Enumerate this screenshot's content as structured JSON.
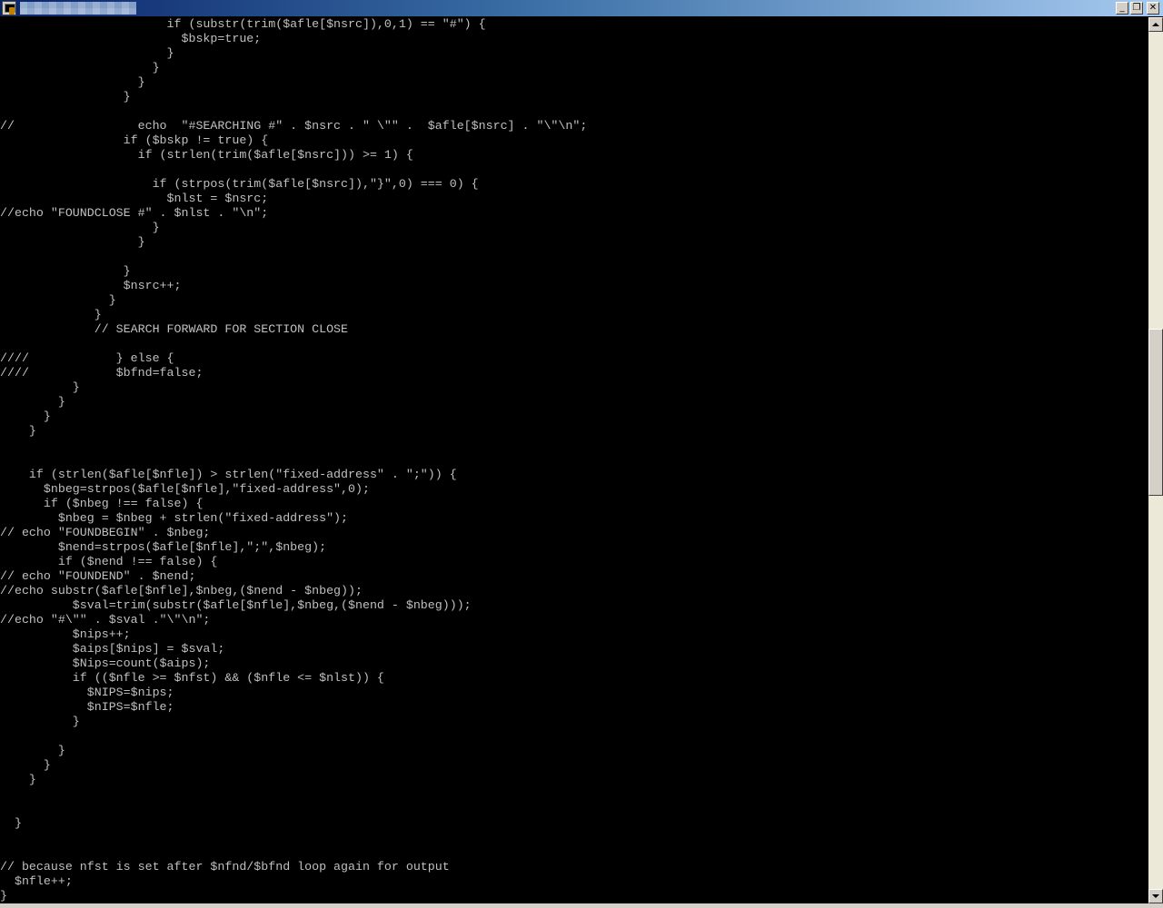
{
  "window": {
    "controls": {
      "minimize_glyph": "_",
      "maximize_glyph": "❐",
      "close_glyph": "✕"
    },
    "icon": "terminal-app-icon"
  },
  "terminal": {
    "text_color": "#c0c0c0",
    "background": "#000000",
    "lines": [
      "                       if (substr(trim($afle[$nsrc]),0,1) == \"#\") {",
      "                         $bskp=true;",
      "                       }",
      "                     }",
      "                   }",
      "                 }",
      "",
      "//                 echo  \"#SEARCHING #\" . $nsrc . \" \\\"\" .  $afle[$nsrc] . \"\\\"\\n\";",
      "                 if ($bskp != true) {",
      "                   if (strlen(trim($afle[$nsrc])) >= 1) {",
      "",
      "                     if (strpos(trim($afle[$nsrc]),\"}\",0) === 0) {",
      "                       $nlst = $nsrc;",
      "//echo \"FOUNDCLOSE #\" . $nlst . \"\\n\";",
      "                     }",
      "                   }",
      "",
      "                 }",
      "                 $nsrc++;",
      "               }",
      "             }",
      "             // SEARCH FORWARD FOR SECTION CLOSE",
      "",
      "////            } else {",
      "////            $bfnd=false;",
      "          }",
      "        }",
      "      }",
      "    }",
      "",
      "",
      "    if (strlen($afle[$nfle]) > strlen(\"fixed-address\" . \";\")) {",
      "      $nbeg=strpos($afle[$nfle],\"fixed-address\",0);",
      "      if ($nbeg !== false) {",
      "        $nbeg = $nbeg + strlen(\"fixed-address\");",
      "// echo \"FOUNDBEGIN\" . $nbeg;",
      "        $nend=strpos($afle[$nfle],\";\",$nbeg);",
      "        if ($nend !== false) {",
      "// echo \"FOUNDEND\" . $nend;",
      "//echo substr($afle[$nfle],$nbeg,($nend - $nbeg));",
      "          $sval=trim(substr($afle[$nfle],$nbeg,($nend - $nbeg)));",
      "//echo \"#\\\"\" . $sval .\"\\\"\\n\";",
      "          $nips++;",
      "          $aips[$nips] = $sval;",
      "          $Nips=count($aips);",
      "          if (($nfle >= $nfst) && ($nfle <= $nlst)) {",
      "            $NIPS=$nips;",
      "            $nIPS=$nfle;",
      "          }",
      "",
      "        }",
      "      }",
      "    }",
      "",
      "",
      "  }",
      "",
      "",
      "// because nfst is set after $nfnd/$bfnd loop again for output",
      "  $nfle++;",
      "}"
    ]
  },
  "scrollbar": {
    "position_fraction": 0.43
  }
}
